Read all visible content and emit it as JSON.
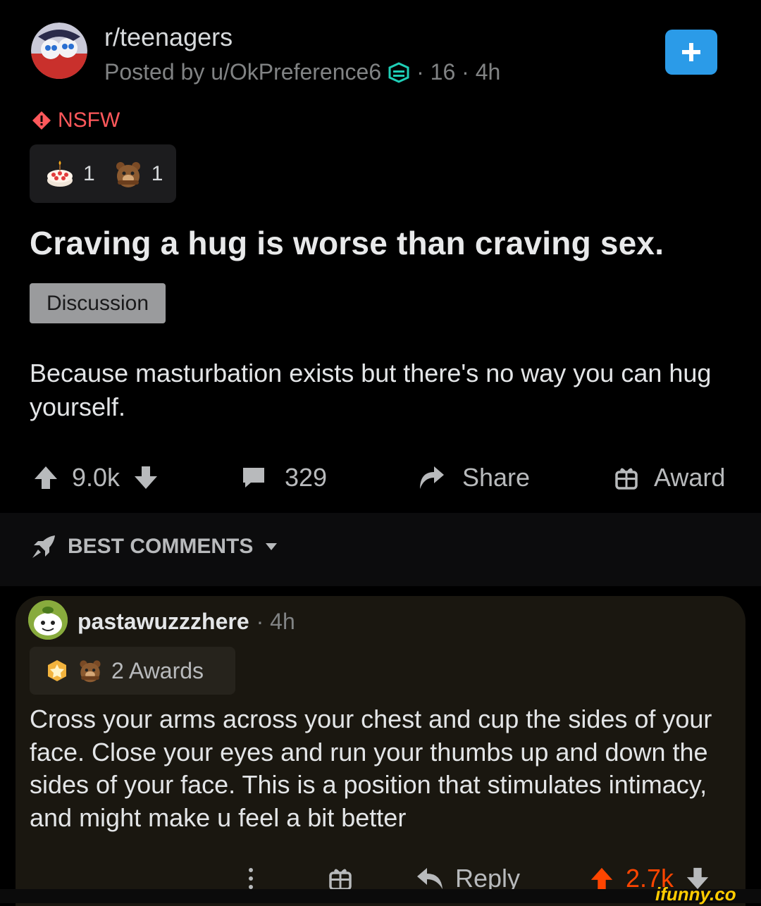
{
  "post": {
    "subreddit": "r/teenagers",
    "posted_by": "Posted by u/OkPreference6",
    "score_flair": "· 16 · 4h",
    "nsfw_label": "NSFW",
    "awards": [
      {
        "icon": "cake-award-icon",
        "count": "1"
      },
      {
        "icon": "bear-award-icon",
        "count": "1"
      }
    ],
    "title": "Craving a hug is worse than craving sex.",
    "flair": "Discussion",
    "body": "Because masturbation exists but there's no way you can hug yourself.",
    "actions": {
      "votes": "9.0k",
      "comments": "329",
      "share": "Share",
      "award": "Award"
    }
  },
  "sort": {
    "label": "BEST COMMENTS"
  },
  "comment": {
    "username": "pastawuzzzhere",
    "time": "· 4h",
    "awards_label": "2 Awards",
    "text": "Cross your arms across your chest and cup the sides of your face. Close your eyes and run your thumbs up and down the sides of your face. This is a position that stimulates intimacy, and might make u feel a bit better",
    "reply_label": "Reply",
    "votes": "2.7k"
  },
  "watermark": "ifunny.co",
  "colors": {
    "accent_blue": "#2b9be8",
    "nsfw_red": "#ff585b",
    "upvote_orange": "#ff4500"
  }
}
